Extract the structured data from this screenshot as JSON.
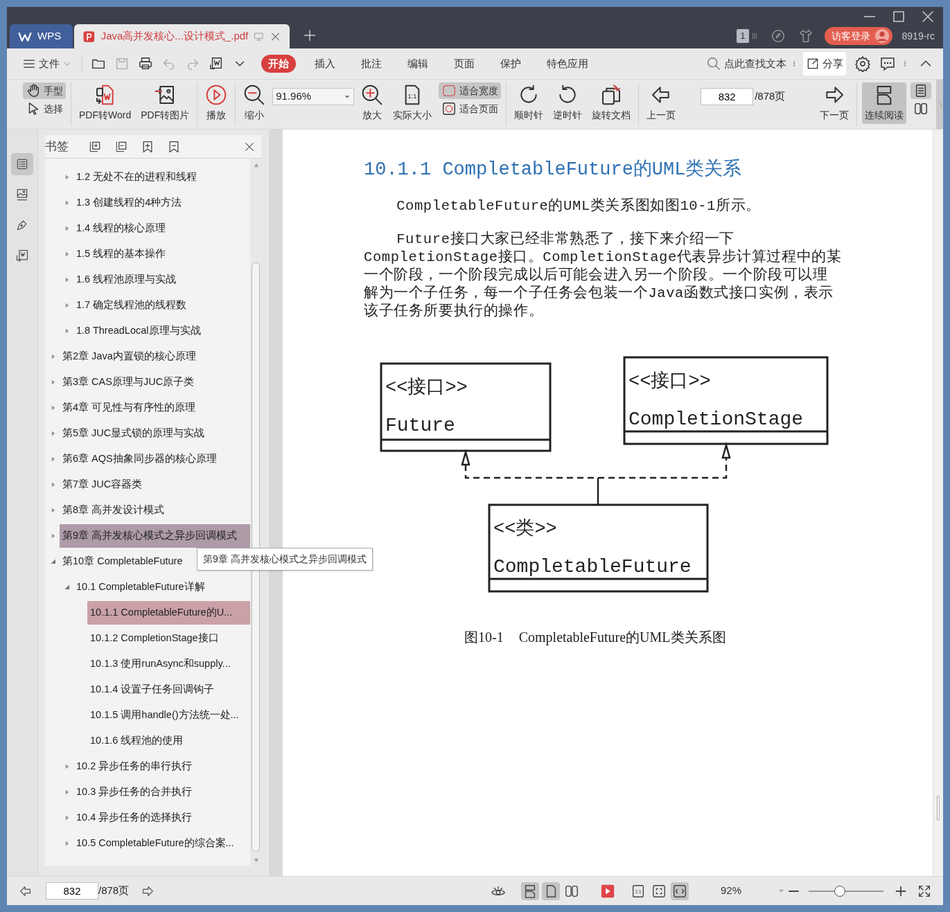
{
  "tabs": [
    {
      "kind": "home",
      "label": "WPS",
      "selected": false
    },
    {
      "kind": "document",
      "label": "Java高并发核心...设计模式_.pdf",
      "selected": true
    }
  ],
  "title_bar": {
    "window_count": "1",
    "login_button": "访客登录",
    "account_label": "8919-rc"
  },
  "menu_bar": {
    "file_menu": "文件",
    "ribbon_tabs": [
      {
        "label": "开始",
        "selected": true
      },
      {
        "label": "插入",
        "selected": false
      },
      {
        "label": "批注",
        "selected": false
      },
      {
        "label": "编辑",
        "selected": false
      },
      {
        "label": "页面",
        "selected": false
      },
      {
        "label": "保护",
        "selected": false
      },
      {
        "label": "特色应用",
        "selected": false
      }
    ],
    "search_hint": "点此查找文本",
    "share_button": "分享"
  },
  "toolbar_groups": [
    {
      "tools": [
        {
          "kind": "stack",
          "items": [
            {
              "label": "手型",
              "selected": true
            },
            {
              "label": "选择",
              "selected": false
            }
          ]
        }
      ]
    },
    {
      "tools": [
        {
          "kind": "big",
          "label": "PDF转Word",
          "selected": false
        },
        {
          "kind": "big",
          "label": "PDF转图片",
          "selected": false
        }
      ]
    },
    {
      "tools": [
        {
          "kind": "big",
          "label": "播放",
          "selected": false
        }
      ]
    },
    {
      "tools": [
        {
          "kind": "big",
          "label": "缩小",
          "selected": false
        },
        {
          "kind": "zoom_field",
          "value": "91.96%"
        },
        {
          "kind": "big",
          "label": "放大",
          "selected": false
        },
        {
          "kind": "big",
          "label": "实际大小",
          "selected": false,
          "icon_text": "1:1"
        },
        {
          "kind": "stack",
          "items": [
            {
              "label": "适合宽度",
              "selected": true
            },
            {
              "label": "适合页面",
              "selected": false
            }
          ]
        }
      ]
    },
    {
      "tools": [
        {
          "kind": "big",
          "label": "顺时针",
          "selected": false
        },
        {
          "kind": "big",
          "label": "逆时针",
          "selected": false
        },
        {
          "kind": "big",
          "label": "旋转文档",
          "selected": false
        }
      ]
    },
    {
      "tools": [
        {
          "kind": "big",
          "label": "上一页",
          "selected": false
        },
        {
          "kind": "page_field",
          "value": "832",
          "total": "/878页"
        },
        {
          "kind": "big",
          "label": "下一页",
          "selected": false
        }
      ]
    },
    {
      "tools": [
        {
          "kind": "big",
          "label": "连续阅读",
          "selected": true
        },
        {
          "kind": "stack",
          "items": [
            {
              "selected": true
            },
            {
              "selected": false
            }
          ]
        }
      ]
    }
  ],
  "sidebar": {
    "rail": [
      {
        "selected": true
      },
      {
        "selected": false
      },
      {
        "selected": false
      },
      {
        "selected": false
      }
    ],
    "title": "书签",
    "bookmarks": [
      {
        "children": [
          {
            "label": "1.2 无处不在的进程和线程",
            "expanded": false,
            "selected": false,
            "hovered": false
          },
          {
            "label": "1.3 创建线程的4种方法",
            "expanded": false,
            "selected": false,
            "hovered": false
          },
          {
            "label": "1.4 线程的核心原理",
            "expanded": false,
            "selected": false,
            "hovered": false
          },
          {
            "label": "1.5 线程的基本操作",
            "expanded": false,
            "selected": false,
            "hovered": false
          },
          {
            "label": "1.6 线程池原理与实战",
            "expanded": false,
            "selected": false,
            "hovered": false
          },
          {
            "label": "1.7 确定线程池的线程数",
            "expanded": false,
            "selected": false,
            "hovered": false
          },
          {
            "label": "1.8 ThreadLocal原理与实战",
            "expanded": false,
            "selected": false,
            "hovered": false
          }
        ]
      },
      {
        "label": "第2章 Java内置锁的核心原理",
        "expanded": false,
        "selected": false,
        "hovered": false
      },
      {
        "label": "第3章 CAS原理与JUC原子类",
        "expanded": false,
        "selected": false,
        "hovered": false
      },
      {
        "label": "第4章 可见性与有序性的原理",
        "expanded": false,
        "selected": false,
        "hovered": false
      },
      {
        "label": "第5章 JUC显式锁的原理与实战",
        "expanded": false,
        "selected": false,
        "hovered": false
      },
      {
        "label": "第6章 AQS抽象同步器的核心原理",
        "expanded": false,
        "selected": false,
        "hovered": false
      },
      {
        "label": "第7章 JUC容器类",
        "expanded": false,
        "selected": false,
        "hovered": false
      },
      {
        "label": "第8章 高并发设计模式",
        "expanded": false,
        "selected": false,
        "hovered": false
      },
      {
        "label": "第9章 高并发核心模式之异步回调模式",
        "expanded": false,
        "selected": false,
        "hovered": true
      },
      {
        "label": "第10章 CompletableFuture",
        "expanded": true,
        "selected": false,
        "hovered": false,
        "children": [
          {
            "label": "10.1 CompletableFuture详解",
            "expanded": true,
            "selected": false,
            "hovered": false,
            "children": [
              {
                "label": "10.1.1 CompletableFuture的U...",
                "selected": true,
                "hovered": false
              },
              {
                "label": "10.1.2 CompletionStage接口",
                "selected": false,
                "hovered": false
              },
              {
                "label": "10.1.3 使用runAsync和supply...",
                "selected": false,
                "hovered": false
              },
              {
                "label": "10.1.4 设置子任务回调钩子",
                "selected": false,
                "hovered": false
              },
              {
                "label": "10.1.5 调用handle()方法统一处...",
                "selected": false,
                "hovered": false
              },
              {
                "label": "10.1.6 线程池的使用",
                "selected": false,
                "hovered": false
              }
            ]
          },
          {
            "label": "10.2 异步任务的串行执行",
            "expanded": false,
            "selected": false,
            "hovered": false
          },
          {
            "label": "10.3 异步任务的合并执行",
            "expanded": false,
            "selected": false,
            "hovered": false
          },
          {
            "label": "10.4 异步任务的选择执行",
            "expanded": false,
            "selected": false,
            "hovered": false
          },
          {
            "label": "10.5 CompletableFuture的综合案...",
            "expanded": false,
            "selected": false,
            "hovered": false
          }
        ]
      }
    ],
    "tooltip": "第9章 高并发核心模式之异步回调模式"
  },
  "document": {
    "heading": "10.1.1  CompletableFuture的UML类关系",
    "paragraphs": [
      "CompletableFuture的UML类关系图如图10-1所示。",
      "Future接口大家已经非常熟悉了，接下来介绍一下CompletionStage接口。CompletionStage代表异步计算过程中的某一个阶段，一个阶段完成以后可能会进入另一个阶段。一个阶段可以理解为一个子任务，每一个子任务会包装一个Java函数式接口实例，表示该子任务所要执行的操作。"
    ],
    "figure": {
      "classes": [
        {
          "stereotype": "<<接口>>",
          "name": "Future"
        },
        {
          "stereotype": "<<接口>>",
          "name": "CompletionStage"
        },
        {
          "stereotype": "<<类>>",
          "name": "CompletableFuture"
        }
      ],
      "caption_number": "图10-1",
      "caption_text": "CompletableFuture的UML类关系图"
    }
  },
  "status_bar": {
    "page_value": "832",
    "page_total": "/878页",
    "view_modes": [
      {
        "selected": true
      },
      {
        "selected": true
      },
      {
        "selected": false
      }
    ],
    "fit_modes": [
      {
        "selected": false,
        "icon_text": "1:1"
      },
      {
        "selected": false
      },
      {
        "selected": true
      }
    ],
    "zoom_value": "92%",
    "zoom_slider": {
      "level": 0.43
    }
  }
}
